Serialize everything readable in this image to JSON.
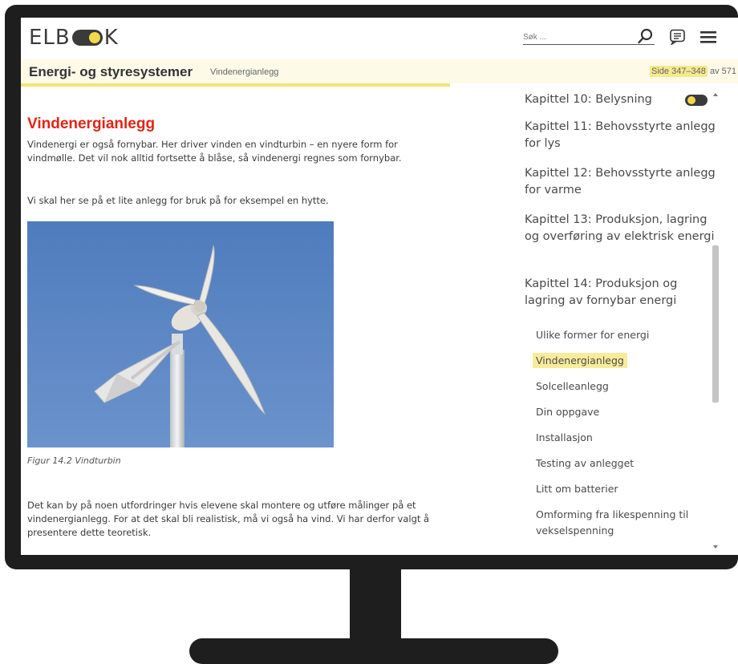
{
  "app": {
    "logo_left": "ELB",
    "logo_right": "K"
  },
  "header": {
    "search_placeholder": "Søk ..."
  },
  "subheader": {
    "section_title": "Energi- og styresystemer",
    "breadcrumb": "Vindenergianlegg",
    "page_range_highlight": "Side 347–348",
    "page_range_suffix": " av 571"
  },
  "article": {
    "title": "Vindenergianlegg",
    "paragraphs": [
      "Vindenergi er også fornybar. Her driver vinden en vindturbin – en nyere form for vindmølle. Det vil nok alltid fortsette å blåse, så vindenergi regnes som fornybar.",
      "Vi skal her se på et lite anlegg for bruk på for eksempel en hytte.",
      "Det kan by på noen utfordringer hvis elevene skal montere og utføre målinger på et vindenergianlegg. For at det skal bli realistisk, må vi også ha vind. Vi har derfor valgt å presentere dette teoretisk."
    ],
    "figure_caption": "Figur 14.2 Vindturbin"
  },
  "toc": {
    "chapters": [
      "Kapittel 10: Belysning",
      "Kapittel 11: Behovsstyrte anlegg for lys",
      "Kapittel 12: Behovsstyrte anlegg for varme",
      "Kapittel 13: Produksjon, lagring og overføring av elektrisk energi",
      "Kapittel 14: Produksjon og lagring av fornybar energi"
    ],
    "subsections": [
      "Ulike former for energi",
      "Vindenergianlegg",
      "Solcelleanlegg",
      "Din oppgave",
      "Installasjon",
      "Testing av anlegget",
      "Litt om batterier",
      "Omforming fra likespenning til vekselspenning"
    ],
    "active_subsection": "Vindenergianlegg"
  },
  "colors": {
    "accent_yellow": "#f3d84a",
    "title_red": "#e32415",
    "frame": "#1e1e1e",
    "sky_blue": "#5c87c5"
  },
  "icons": [
    "search-icon",
    "chat-icon",
    "menu-icon",
    "toggle-icon"
  ]
}
